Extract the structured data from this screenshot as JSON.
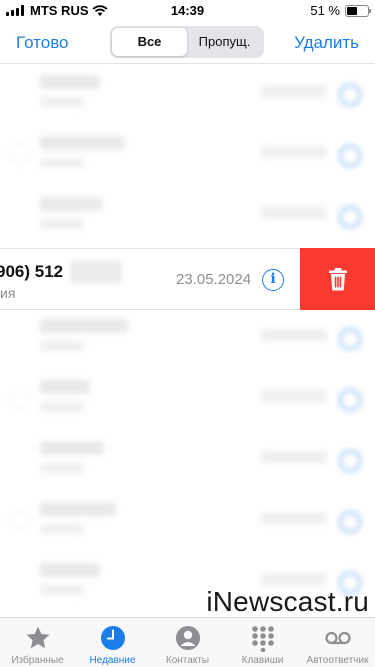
{
  "status_bar": {
    "carrier": "MTS RUS",
    "time": "14:39",
    "battery": "51 %",
    "battery_level": 0.51
  },
  "nav": {
    "left_label": "Готово",
    "right_label": "Удалить",
    "segments": [
      {
        "label": "Все",
        "active": true
      },
      {
        "label": "Пропущ.",
        "active": false
      }
    ]
  },
  "swiped_row": {
    "number": "906) 512",
    "label": "ия",
    "date": "23.05.2024",
    "info_icon": "info-circle-icon",
    "delete_icon": "trash-icon"
  },
  "watermark": "iNewscast.ru",
  "tabs": [
    {
      "label": "Избранные",
      "icon": "star-icon",
      "active": false
    },
    {
      "label": "Недавние",
      "icon": "clock-icon",
      "active": true
    },
    {
      "label": "Контакты",
      "icon": "person-icon",
      "active": false
    },
    {
      "label": "Клавиши",
      "icon": "keypad-icon",
      "active": false
    },
    {
      "label": "Автоответчик",
      "icon": "voicemail-icon",
      "active": false
    }
  ],
  "colors": {
    "accent": "#1b7ee8",
    "delete": "#fa3a30"
  }
}
